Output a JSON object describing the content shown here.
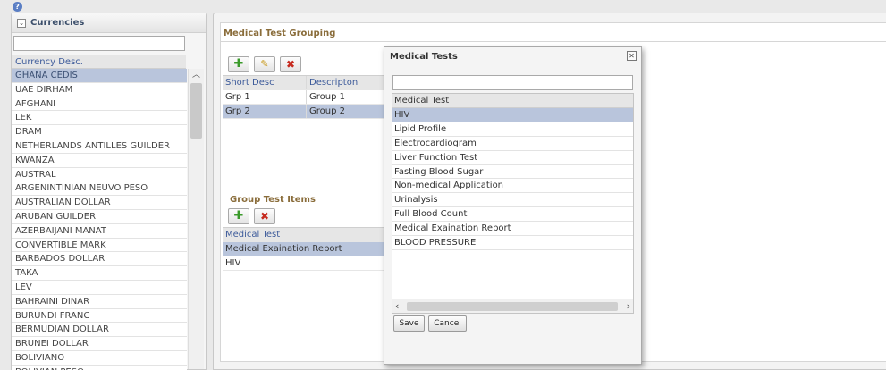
{
  "help": {
    "icon": "help-icon",
    "glyph": "?"
  },
  "currencies": {
    "title": "Currencies",
    "filter_value": "",
    "column_header": "Currency Desc.",
    "items": [
      "GHANA CEDIS",
      "UAE DIRHAM",
      "AFGHANI",
      "LEK",
      "DRAM",
      "NETHERLANDS ANTILLES GUILDER",
      "KWANZA",
      "AUSTRAL",
      "ARGENINTINIAN NEUVO PESO",
      "AUSTRALIAN DOLLAR",
      "ARUBAN GUILDER",
      "AZERBAIJANI MANAT",
      "CONVERTIBLE MARK",
      "BARBADOS DOLLAR",
      "TAKA",
      "LEV",
      "BAHRAINI DINAR",
      "BURUNDI FRANC",
      "BERMUDIAN DOLLAR",
      "BRUNEI DOLLAR",
      "BOLIVIANO",
      "BOLIVIAN PESO"
    ],
    "selected_index": 0
  },
  "grouping": {
    "title": "Medical Test Grouping",
    "columns": [
      "Short Desc",
      "Descripton"
    ],
    "rows": [
      {
        "short": "Grp 1",
        "desc": "Group 1"
      },
      {
        "short": "Grp 2",
        "desc": "Group 2"
      }
    ],
    "selected_index": 1
  },
  "group_items": {
    "title": "Group Test Items",
    "column": "Medical Test",
    "rows": [
      "Medical Exaination Report",
      "HIV"
    ],
    "selected_index": 0
  },
  "dialog": {
    "title": "Medical Tests",
    "search_value": "",
    "column": "Medical Test",
    "items": [
      "HIV",
      "Lipid Profile",
      "Electrocardiogram",
      "Liver Function Test",
      "Fasting Blood Sugar",
      "Non-medical Application",
      "Urinalysis",
      "Full Blood Count",
      "Medical Exaination Report",
      "BLOOD PRESSURE"
    ],
    "selected_index": 0,
    "save_label": "Save",
    "cancel_label": "Cancel"
  },
  "colors": {
    "selected_row": "#b9c5dc",
    "section_title": "#8a6d3b",
    "column_header_text": "#3c5a9a"
  }
}
